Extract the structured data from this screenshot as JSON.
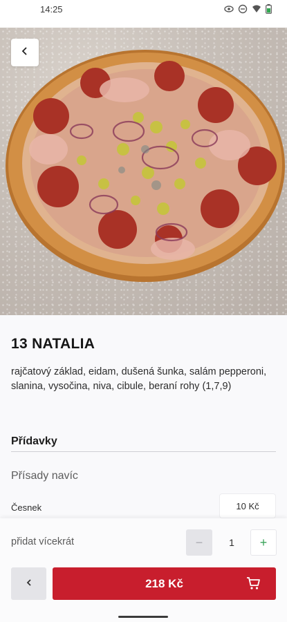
{
  "status_bar": {
    "time": "14:25"
  },
  "product": {
    "title": "13 NATALIA",
    "description": "rajčatový základ, eidam, dušená šunka, salám pepperoni, slanina, vysočina, niva, cibule, beraní rohy (1,7,9)"
  },
  "extras": {
    "section_title": "Přídavky",
    "group_label": "Přísady navíc",
    "items": [
      {
        "name": "Česnek",
        "price": "10 Kč"
      }
    ]
  },
  "quantity": {
    "label": "přidat vícekrát",
    "minus": "−",
    "value": "1",
    "plus": "+"
  },
  "cart": {
    "back_label": "‹",
    "price": "218 Kč"
  },
  "colors": {
    "accent": "#c81e2d",
    "plus": "#3aa35a",
    "background": "#f9f9fb"
  },
  "icons": [
    "eye-icon",
    "dnd-icon",
    "wifi-icon",
    "battery-icon",
    "back-icon",
    "cart-icon"
  ]
}
